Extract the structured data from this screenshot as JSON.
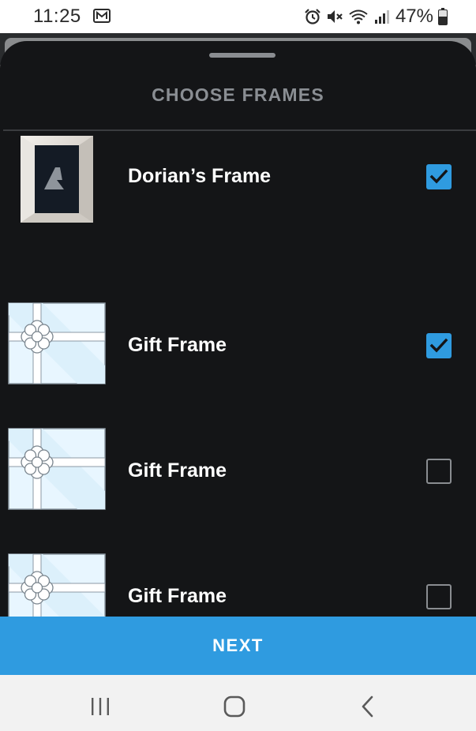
{
  "status_bar": {
    "time": "11:25",
    "battery_percent": "47%",
    "icons": [
      "mail-icon",
      "alarm-icon",
      "mute-icon",
      "wifi-icon",
      "signal-icon",
      "battery-icon"
    ]
  },
  "sheet": {
    "title": "CHOOSE FRAMES",
    "frames": [
      {
        "name": "Dorian’s Frame",
        "thumbnail": "dark-frame",
        "checked": true
      },
      {
        "name": "Gift Frame",
        "thumbnail": "gift-frame",
        "checked": true
      },
      {
        "name": "Gift Frame",
        "thumbnail": "gift-frame",
        "checked": false
      },
      {
        "name": "Gift Frame",
        "thumbnail": "gift-frame",
        "checked": false
      }
    ]
  },
  "next_button": {
    "label": "NEXT"
  },
  "nav_bar": {
    "icons": [
      "recent-apps-icon",
      "home-icon",
      "back-icon"
    ]
  },
  "colors": {
    "accent": "#2f9be0",
    "sheet_background": "#141517",
    "title_text": "#8a8e93"
  }
}
